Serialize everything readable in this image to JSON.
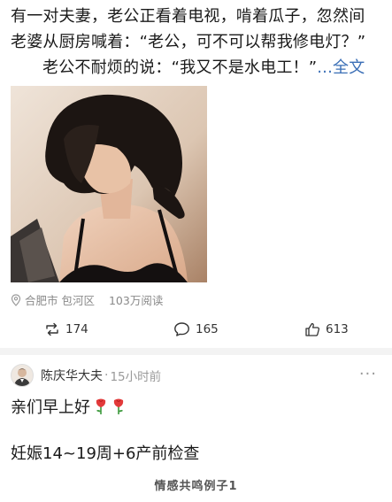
{
  "post": {
    "line1": "有一对夫妻，老公正看着电视，啃着瓜子，忽然间",
    "line2": "老婆从厨房喊着：“老公，可不可以帮我修电灯？”",
    "line3": "老公不耐烦的说：“我又不是水电工！”",
    "more": "...全文",
    "location": "合肥市 包河区",
    "views": "103万阅读"
  },
  "actions": {
    "repost": "174",
    "comment": "165",
    "like": "613"
  },
  "comment": {
    "author": "陈庆华大夫",
    "separator": "·",
    "time": "15小时前",
    "greeting": "亲们早上好",
    "pregnancy": "妊娠14~19周+6产前检查"
  },
  "caption": "情感共鸣例子1",
  "colors": {
    "link": "#3b6fb6",
    "divider": "#f3f3f3",
    "meta": "#8a8a8a"
  },
  "icons": [
    "location-pin-icon",
    "repost-icon",
    "comment-icon",
    "like-icon",
    "more-dots-icon",
    "rose-icon"
  ]
}
